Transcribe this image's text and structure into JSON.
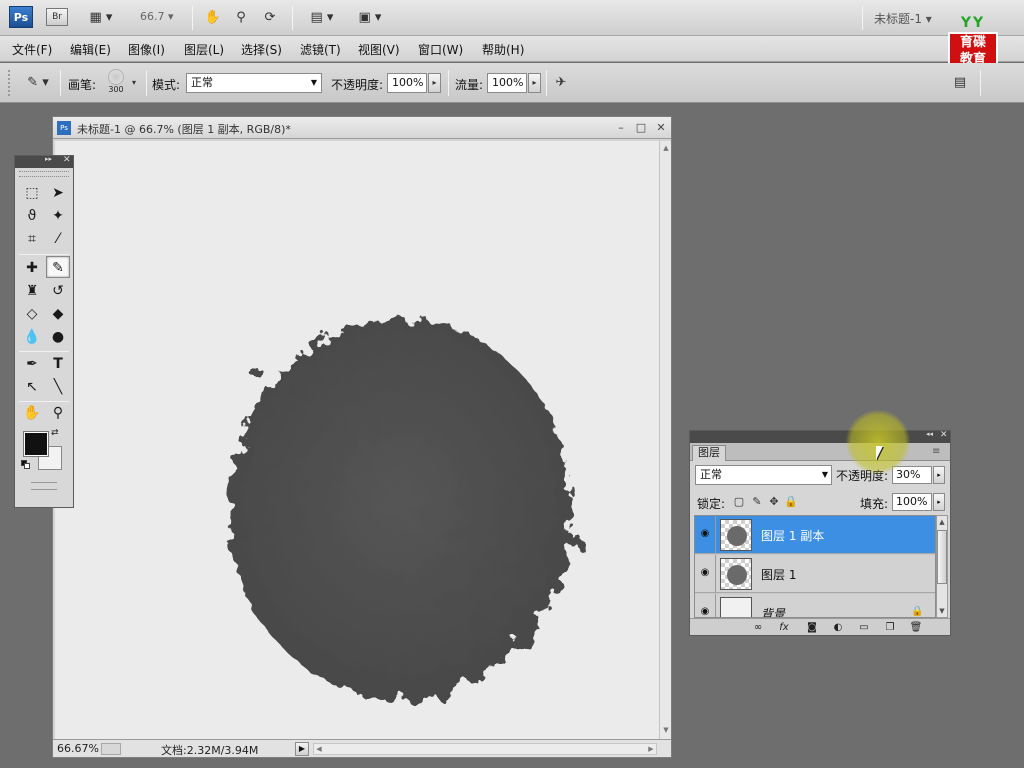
{
  "app": {
    "logo": "Ps",
    "bridge": "Br",
    "zoom_value": "66.7",
    "title": "未标题-1"
  },
  "appbar_icons": [
    "view-extras-icon",
    "hand-icon",
    "zoom-icon",
    "rotate-view-icon",
    "arrange-documents-icon",
    "screen-mode-icon"
  ],
  "menu": {
    "items": [
      "文件(F)",
      "编辑(E)",
      "图像(I)",
      "图层(L)",
      "选择(S)",
      "滤镜(T)",
      "视图(V)",
      "窗口(W)",
      "帮助(H)"
    ]
  },
  "badge": {
    "top": "YY",
    "line1": "育碟",
    "line2": "教育"
  },
  "options": {
    "brush_label": "画笔:",
    "brush_size": "300",
    "mode_label": "模式:",
    "mode_value": "正常",
    "opacity_label": "不透明度:",
    "opacity_value": "100%",
    "flow_label": "流量:",
    "flow_value": "100%"
  },
  "document": {
    "title": "未标题-1 @ 66.7% (图层 1 副本, RGB/8)*",
    "zoom": "66.67%",
    "doc_size": "文档:2.32M/3.94M"
  },
  "layers_panel": {
    "tab": "图层",
    "blend_mode": "正常",
    "opacity_label": "不透明度:",
    "opacity_value": "30%",
    "lock_label": "锁定:",
    "fill_label": "填充:",
    "fill_value": "100%",
    "layers": [
      {
        "name": "图层 1 副本",
        "selected": true
      },
      {
        "name": "图层 1",
        "selected": false
      },
      {
        "name": "背景",
        "selected": false
      }
    ]
  },
  "colors": {
    "foreground": "#111111",
    "background": "#f2f2f2",
    "selection": "#3c8fe3"
  }
}
